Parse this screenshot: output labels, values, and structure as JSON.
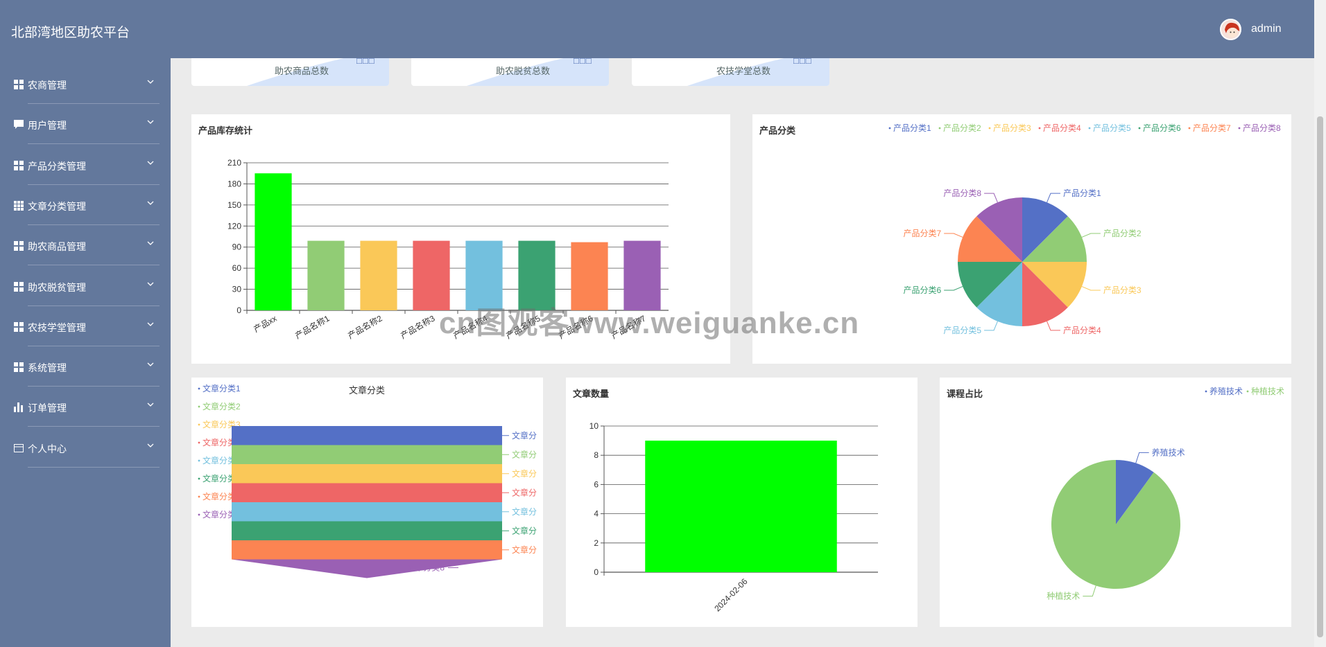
{
  "app": {
    "title": "北部湾地区助农平台",
    "user": "admin"
  },
  "sidebar": {
    "items": [
      {
        "label": "农商管理",
        "icon": "grid-icon"
      },
      {
        "label": "用户管理",
        "icon": "chat-icon"
      },
      {
        "label": "产品分类管理",
        "icon": "grid-icon"
      },
      {
        "label": "文章分类管理",
        "icon": "table-icon"
      },
      {
        "label": "助农商品管理",
        "icon": "grid-icon"
      },
      {
        "label": "助农脱贫管理",
        "icon": "grid-icon"
      },
      {
        "label": "农技学堂管理",
        "icon": "grid-icon"
      },
      {
        "label": "系统管理",
        "icon": "grid-icon"
      },
      {
        "label": "订单管理",
        "icon": "bar-chart-icon"
      },
      {
        "label": "个人中心",
        "icon": "card-icon"
      }
    ]
  },
  "stats": [
    {
      "label": "助农商品总数",
      "value": "□□□"
    },
    {
      "label": "助农脱贫总数",
      "value": "□□□"
    },
    {
      "label": "农技学堂总数",
      "value": "□□□"
    }
  ],
  "colors": [
    "#5470c6",
    "#91cc75",
    "#fac858",
    "#ee6666",
    "#73c0de",
    "#3ba272",
    "#fc8452",
    "#9a60b4"
  ],
  "chart_data": [
    {
      "type": "bar",
      "title": "产品库存统计",
      "categories": [
        "产品xx",
        "产品名称1",
        "产品名称2",
        "产品名称3",
        "产品名称4",
        "产品名称5",
        "产品名称6",
        "产品名称7"
      ],
      "values": [
        195,
        99,
        99,
        99,
        99,
        99,
        97,
        99
      ],
      "bar_colors": [
        "#00ff00",
        "#91cc75",
        "#fac858",
        "#ee6666",
        "#73c0de",
        "#3ba272",
        "#fc8452",
        "#9a60b4"
      ],
      "yticks": [
        "0",
        "30",
        "60",
        "90",
        "120",
        "150",
        "180",
        "210"
      ],
      "ylim": [
        0,
        210
      ]
    },
    {
      "type": "pie",
      "title": "产品分类",
      "labels": [
        "产品分类1",
        "产品分类2",
        "产品分类3",
        "产品分类4",
        "产品分类5",
        "产品分类6",
        "产品分类7",
        "产品分类8"
      ],
      "values": [
        1,
        1,
        1,
        1,
        1,
        1,
        1,
        1
      ],
      "legend": "top-right"
    },
    {
      "type": "funnel",
      "title": "文章分类",
      "labels": [
        "文章分类1",
        "文章分类2",
        "文章分类3",
        "文章分类4",
        "文章分类5",
        "文章分类6",
        "文章分类7",
        "文章分类8"
      ],
      "side_labels": [
        "文章分",
        "文章分",
        "文章分",
        "文章分",
        "文章分",
        "文章分",
        "文章分",
        "文章分类8"
      ],
      "values": [
        8,
        8,
        8,
        8,
        8,
        8,
        8,
        4
      ],
      "legend": "left"
    },
    {
      "type": "bar",
      "title": "文章数量",
      "categories": [
        "2024-02-06"
      ],
      "values": [
        9
      ],
      "yticks": [
        "0",
        "2",
        "4",
        "6",
        "8",
        "10"
      ],
      "ylim": [
        0,
        10
      ]
    },
    {
      "type": "pie",
      "title": "课程占比",
      "labels": [
        "养殖技术",
        "种植技术"
      ],
      "values": [
        1,
        9
      ],
      "legend": "top-right"
    }
  ],
  "watermark": "cn图观客www.weiguanke.cn"
}
